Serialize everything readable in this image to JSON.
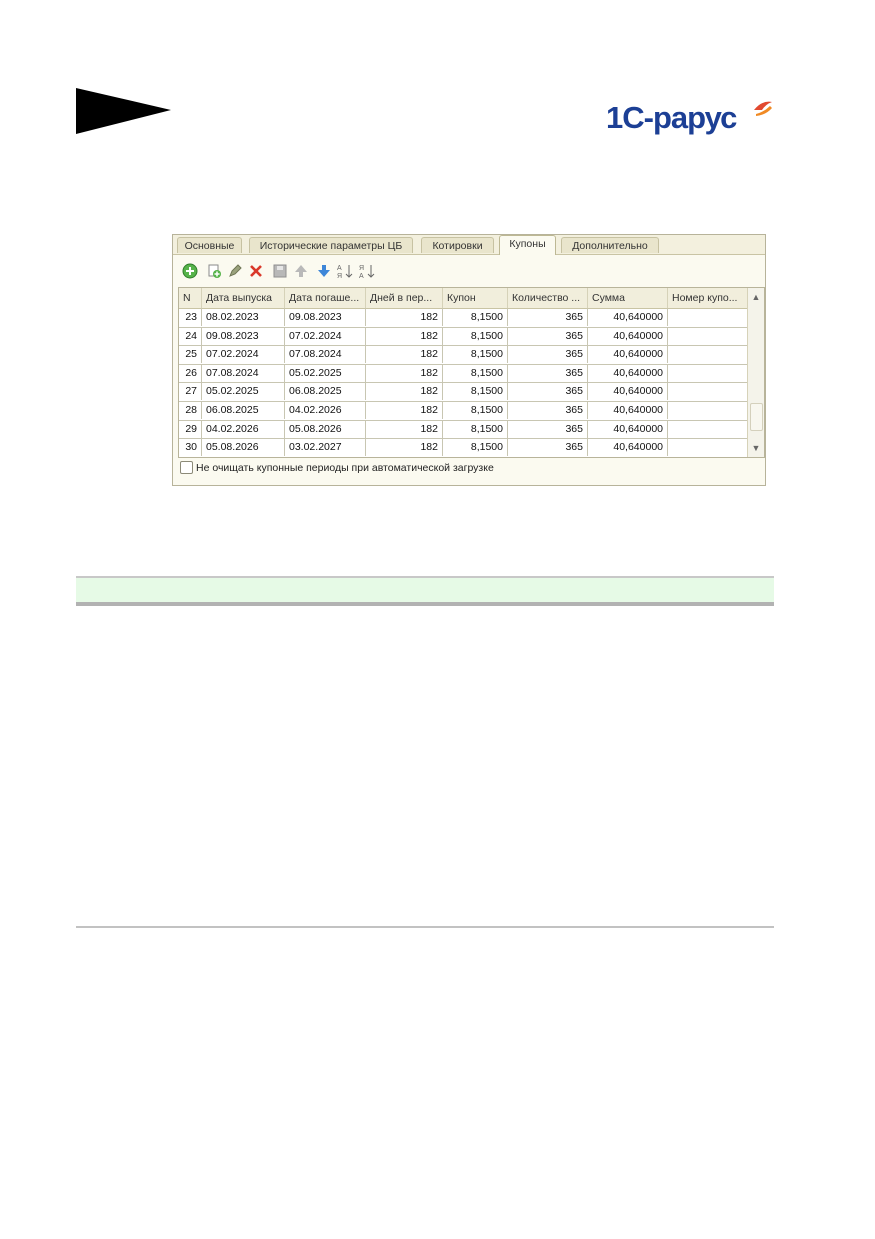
{
  "logo": {
    "text": "1С-рарус"
  },
  "tabs": [
    "Основные",
    "Исторические параметры ЦБ",
    "Котировки",
    "Купоны",
    "Дополнительно"
  ],
  "active_tab": "Купоны",
  "toolbar": [
    "add-icon",
    "copy-icon",
    "edit-icon",
    "delete-icon",
    "save-icon",
    "move-up-icon",
    "move-down-icon",
    "sort-asc-icon",
    "sort-desc-icon"
  ],
  "table": {
    "columns": [
      "N",
      "Дата выпуска",
      "Дата погаше...",
      "Дней в пер...",
      "Купон",
      "Количество ...",
      "Сумма",
      "Номер купо..."
    ],
    "rows": [
      [
        "23",
        "08.02.2023",
        "09.08.2023",
        "182",
        "8,1500",
        "365",
        "40,640000",
        ""
      ],
      [
        "24",
        "09.08.2023",
        "07.02.2024",
        "182",
        "8,1500",
        "365",
        "40,640000",
        ""
      ],
      [
        "25",
        "07.02.2024",
        "07.08.2024",
        "182",
        "8,1500",
        "365",
        "40,640000",
        ""
      ],
      [
        "26",
        "07.08.2024",
        "05.02.2025",
        "182",
        "8,1500",
        "365",
        "40,640000",
        ""
      ],
      [
        "27",
        "05.02.2025",
        "06.08.2025",
        "182",
        "8,1500",
        "365",
        "40,640000",
        ""
      ],
      [
        "28",
        "06.08.2025",
        "04.02.2026",
        "182",
        "8,1500",
        "365",
        "40,640000",
        ""
      ],
      [
        "29",
        "04.02.2026",
        "05.08.2026",
        "182",
        "8,1500",
        "365",
        "40,640000",
        ""
      ],
      [
        "30",
        "05.08.2026",
        "03.02.2027",
        "182",
        "8,1500",
        "365",
        "40,640000",
        ""
      ]
    ]
  },
  "checkbox": {
    "label": "Не очищать купонные периоды при автоматической загрузке",
    "checked": false
  }
}
